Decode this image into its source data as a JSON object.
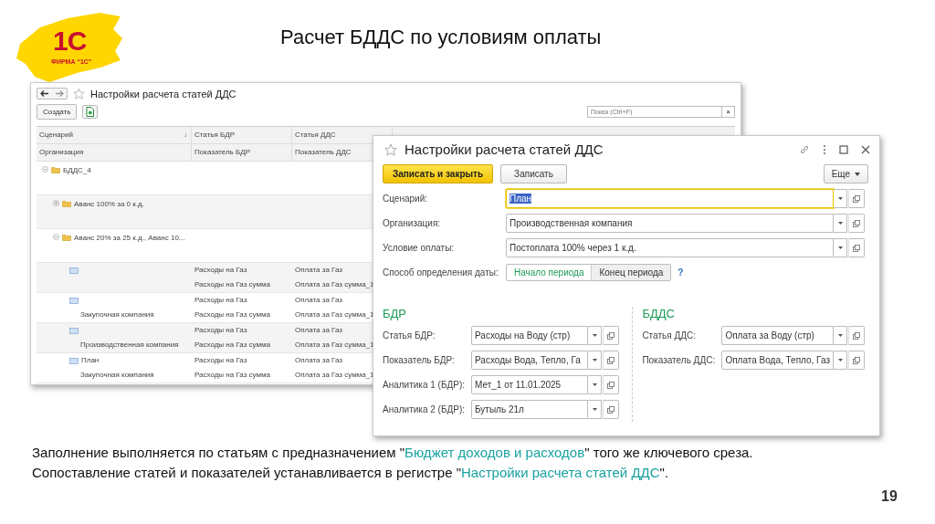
{
  "logo": {
    "mark": "1С",
    "caption": "ФИРМА “1С”"
  },
  "title": "Расчет БДДС по условиям оплаты",
  "list_window": {
    "title": "Настройки расчета статей ДДС",
    "create_button": "Создать",
    "search": {
      "placeholder": "Поиск (Ctrl+F)"
    },
    "clear_button": "×",
    "columns": [
      {
        "top": "Сценарий",
        "bottom": "Организация",
        "sort_mark": "↓"
      },
      {
        "top": "Статья БДР",
        "bottom": "Показатель БДР"
      },
      {
        "top": "Статья ДДС",
        "bottom": "Показатель ДДС"
      }
    ],
    "rows": [
      {
        "kind": "group",
        "label": "БДДС_4",
        "expanded": true,
        "children": [
          {
            "kind": "group",
            "label": "Аванс 100% за 0 к.д.",
            "expanded": false
          },
          {
            "kind": "group",
            "label": "Аванс 20% за 25 к.д., Аванс 10...",
            "expanded": true,
            "children": [
              {
                "kind": "item",
                "bdr_item": "Расходы на Газ",
                "dds_item": "Оплата за Газ",
                "bdr_indicator": "Расходы на Газ сумма",
                "dds_indicator": "Оплата за Газ сумма_1"
              },
              {
                "kind": "item",
                "organization": "Закупочная компания",
                "bdr_item": "Расходы на Газ",
                "dds_item": "Оплата за Газ",
                "bdr_indicator": "Расходы на Газ сумма",
                "dds_indicator": "Оплата за Газ сумма_1"
              },
              {
                "kind": "item",
                "organization": "Производственная компания",
                "bdr_item": "Расходы на Газ",
                "dds_item": "Оплата за Газ",
                "bdr_indicator": "Расходы на Газ сумма",
                "dds_indicator": "Оплата за Газ сумма_1"
              },
              {
                "kind": "item",
                "scenario": "План",
                "organization": "Закупочная компания",
                "bdr_item": "Расходы на Газ",
                "dds_item": "Оплата за Газ",
                "bdr_indicator": "Расходы на Газ сумма",
                "dds_indicator": "Оплата за Газ сумма_1"
              }
            ]
          }
        ]
      }
    ]
  },
  "dialog": {
    "title": "Настройки расчета статей ДДС",
    "buttons": [
      {
        "label": "Записать и закрыть",
        "kind": "primary"
      },
      {
        "label": "Записать",
        "kind": "normal"
      }
    ],
    "more_button": "Еще",
    "fields": [
      {
        "label": "Сценарий:",
        "value": "План",
        "focused": true,
        "highlighted": true
      },
      {
        "label": "Организация:",
        "value": "Производственная компания",
        "focused": false,
        "highlighted": false
      },
      {
        "label": "Условие оплаты:",
        "value": "Постоплата 100% через 1 к.д.",
        "focused": false,
        "highlighted": false
      }
    ],
    "date_method": {
      "label": "Способ определения даты:",
      "options": [
        {
          "label": "Начало периода",
          "selected": true
        },
        {
          "label": "Конец периода",
          "selected": false
        }
      ],
      "help": "?"
    },
    "sections": [
      {
        "heading": "БДР",
        "fields": [
          {
            "label": "Статья БДР:",
            "value": "Расходы на Воду (стр)"
          },
          {
            "label": "Показатель БДР:",
            "value": "Расходы Вода, Тепло, Га"
          },
          {
            "label": "Аналитика 1 (БДР):",
            "value": "Мет_1 от 11.01.2025"
          },
          {
            "label": "Аналитика 2 (БДР):",
            "value": "Бутыль 21л"
          }
        ]
      },
      {
        "heading": "БДДС",
        "fields": [
          {
            "label": "Статья ДДС:",
            "value": "Оплата за Воду (стр)"
          },
          {
            "label": "Показатель ДДС:",
            "value": "Оплата Вода, Тепло, Газ"
          }
        ]
      }
    ]
  },
  "notes": [
    {
      "parts": [
        {
          "text": "Заполнение выполняется по статьям с предназначением \"",
          "highlight": false
        },
        {
          "text": "Бюджет доходов и расходов",
          "highlight": true
        },
        {
          "text": "\" того же ключевого среза.",
          "highlight": false
        }
      ]
    },
    {
      "parts": [
        {
          "text": "Сопоставление статей и показателей устанавливается в регистре \"",
          "highlight": false
        },
        {
          "text": "Настройки расчета статей ДДС",
          "highlight": true
        },
        {
          "text": "\".",
          "highlight": false
        }
      ]
    }
  ],
  "page_number": "19"
}
